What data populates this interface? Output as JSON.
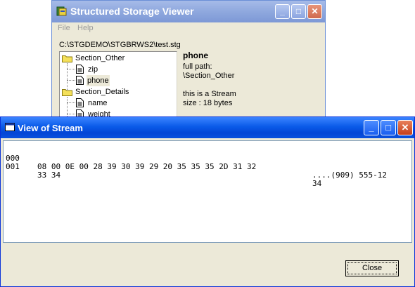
{
  "background_window": {
    "title": "Structured Storage Viewer",
    "menu": [
      "File",
      "Help"
    ],
    "path": "C:\\STGDEMO\\STGBRWS2\\test.stg",
    "tree": [
      {
        "label": "Section_Other",
        "type": "folder",
        "level": 0
      },
      {
        "label": "zip",
        "type": "stream",
        "level": 1
      },
      {
        "label": "phone",
        "type": "stream",
        "level": 1,
        "selected": true
      },
      {
        "label": "Section_Details",
        "type": "folder",
        "level": 0
      },
      {
        "label": "name",
        "type": "stream",
        "level": 1
      },
      {
        "label": "weight",
        "type": "stream",
        "level": 1
      }
    ],
    "info": {
      "name": "phone",
      "full_path_label": "full path:",
      "full_path": "\\Section_Other",
      "type_text": "this is a Stream",
      "size_text": "size : 18 bytes"
    }
  },
  "dialog": {
    "title": "View of Stream",
    "hex_rows": [
      {
        "offset": "000",
        "bytes": "08 00 0E 00 28 39 30 39 29 20 35 35 35 2D 31 32",
        "ascii": "....(909) 555-12"
      },
      {
        "offset": "001",
        "bytes": "33 34",
        "ascii": "34"
      }
    ],
    "close_label": "Close"
  },
  "colors": {
    "active_titlebar": "#0a5ae8",
    "inactive_titlebar": "#8fa8de",
    "window_face": "#ece9d8",
    "close_button_red": "#c6401a"
  }
}
